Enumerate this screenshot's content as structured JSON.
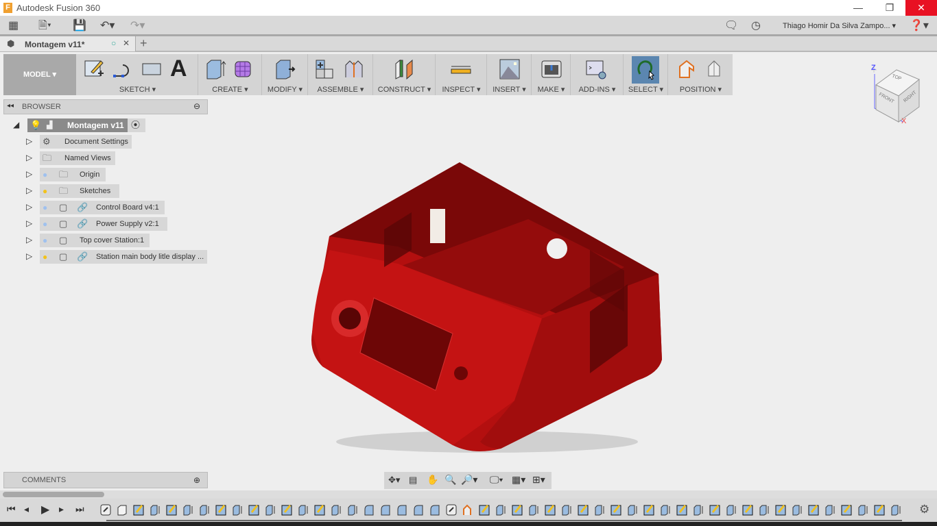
{
  "app": {
    "title": "Autodesk Fusion 360",
    "user": "Thiago Homir Da Silva Zampo...",
    "document_tab": "Montagem v11*"
  },
  "toolbar": {
    "workspace": "MODEL",
    "groups": [
      {
        "label": "SKETCH"
      },
      {
        "label": "CREATE"
      },
      {
        "label": "MODIFY"
      },
      {
        "label": "ASSEMBLE"
      },
      {
        "label": "CONSTRUCT"
      },
      {
        "label": "INSPECT"
      },
      {
        "label": "INSERT"
      },
      {
        "label": "MAKE"
      },
      {
        "label": "ADD-INS"
      },
      {
        "label": "SELECT"
      },
      {
        "label": "POSITION"
      }
    ]
  },
  "browser": {
    "title": "BROWSER",
    "root": "Montagem v11",
    "items": [
      {
        "label": "Document Settings",
        "icon": "gear-icon"
      },
      {
        "label": "Named Views",
        "icon": "folder-icon"
      },
      {
        "label": "Origin",
        "icon": "folder-icon",
        "bulb": "off"
      },
      {
        "label": "Sketches",
        "icon": "folder-icon",
        "bulb": "on"
      },
      {
        "label": "Control Board v4:1",
        "icon": "component-icon",
        "bulb": "off",
        "link": true
      },
      {
        "label": "Power Supply v2:1",
        "icon": "component-icon",
        "bulb": "off",
        "link": true
      },
      {
        "label": "Top cover Station:1",
        "icon": "component-icon",
        "bulb": "off"
      },
      {
        "label": "Station main body litle display ...",
        "icon": "component-icon",
        "bulb": "on",
        "link": true
      }
    ]
  },
  "comments": {
    "title": "COMMENTS"
  },
  "viewcube": {
    "faces": [
      "TOP",
      "FRONT",
      "RIGHT"
    ],
    "axes": [
      "Z",
      "X"
    ]
  },
  "model_color": "#b30f0f",
  "timeline": {
    "steps": [
      "link",
      "box",
      "sketch",
      "extrude",
      "sketch",
      "extrude",
      "extrude",
      "sketch",
      "extrude",
      "sketch",
      "extrude",
      "sketch",
      "extrude",
      "sketch",
      "extrude",
      "extrude",
      "fillet",
      "fillet",
      "fillet",
      "fillet",
      "fillet",
      "link",
      "joint",
      "sketch",
      "extrude",
      "sketch",
      "extrude",
      "sketch",
      "extrude",
      "sketch",
      "extrude",
      "sketch",
      "extrude",
      "sketch",
      "extrude",
      "sketch",
      "extrude",
      "sketch",
      "extrude",
      "sketch",
      "extrude",
      "sketch",
      "extrude",
      "sketch",
      "extrude",
      "sketch",
      "extrude",
      "sketch",
      "extrude"
    ]
  }
}
